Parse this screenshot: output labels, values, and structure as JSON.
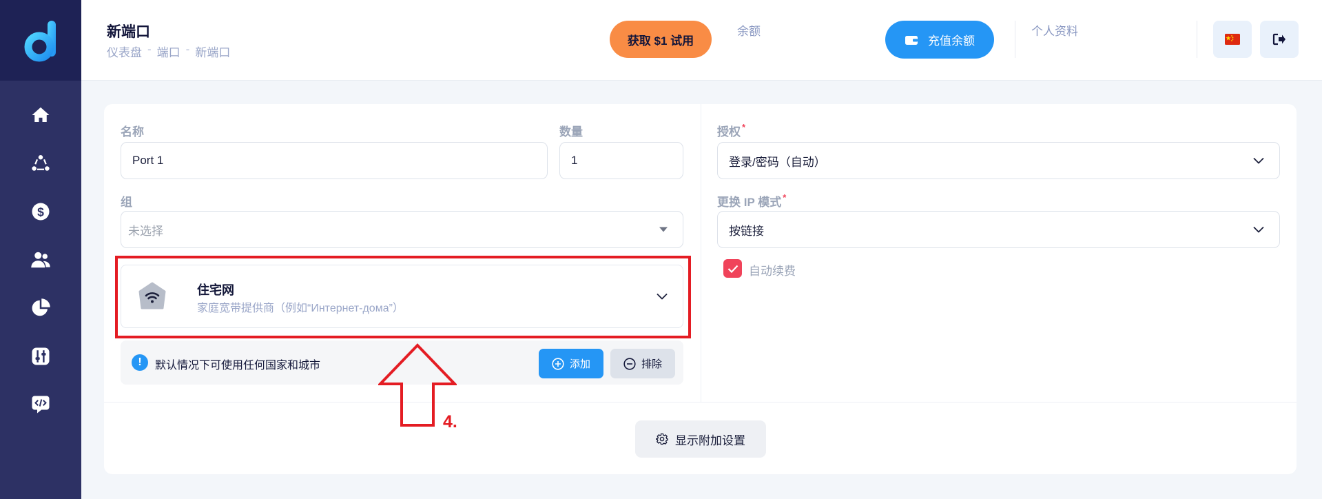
{
  "colors": {
    "sidebar": "#2d3164",
    "sidebar_top": "#1e2255",
    "accent": "#2596f5",
    "trial": "#f98c45",
    "required": "#f0435a",
    "annotation": "#e41c23"
  },
  "sidebar": {
    "logo": "d-logo-icon",
    "items": [
      {
        "icon": "home-icon"
      },
      {
        "icon": "network-icon"
      },
      {
        "icon": "dollar-icon"
      },
      {
        "icon": "users-icon"
      },
      {
        "icon": "pie-chart-icon"
      },
      {
        "icon": "sliders-icon"
      },
      {
        "icon": "code-icon"
      }
    ]
  },
  "header": {
    "title": "新端口",
    "breadcrumb": [
      "仪表盘",
      "端口",
      "新端口"
    ],
    "breadcrumb_sep": "-",
    "trial_button": "获取 $1 试用",
    "balance_label": "余额",
    "topup_button": "充值余额",
    "profile_label": "个人资料",
    "flag_icon": "china-flag-icon",
    "logout_icon": "logout-icon"
  },
  "form": {
    "name_label": "名称",
    "name_value": "Port 1",
    "qty_label": "数量",
    "qty_value": "1",
    "group_label": "组",
    "group_placeholder": "未选择",
    "auth_label": "授权",
    "auth_required": "*",
    "auth_value": "登录/密码（自动）",
    "rotate_label": "更换 IP 模式",
    "rotate_required": "*",
    "rotate_value": "按链接",
    "autorenew_label": "自动续费",
    "autorenew_checked": true
  },
  "region": {
    "title": "住宅网",
    "subtitle": "家庭宽带提供商（例如“Интернет-дома”）"
  },
  "info": {
    "text": "默认情况下可使用任何国家和城市",
    "add_button": "添加",
    "exclude_button": "排除"
  },
  "more_settings_button": "显示附加设置",
  "annotation": {
    "step": "4."
  }
}
